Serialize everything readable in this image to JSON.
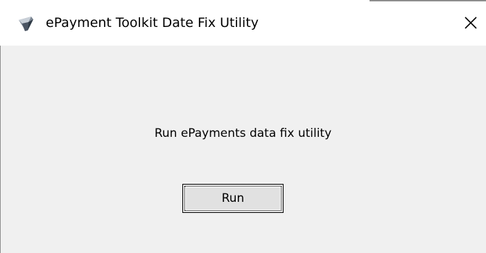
{
  "window": {
    "title": "ePayment Toolkit Date Fix Utility",
    "icon": "epayment-app-icon",
    "close_icon": "close-icon"
  },
  "main": {
    "prompt_text": "Run ePayments data fix utility",
    "run_label": "Run"
  },
  "colors": {
    "titlebar_bg": "#ffffff",
    "client_bg": "#f0f0f0",
    "button_bg": "#e1e1e1",
    "text": "#000000"
  }
}
